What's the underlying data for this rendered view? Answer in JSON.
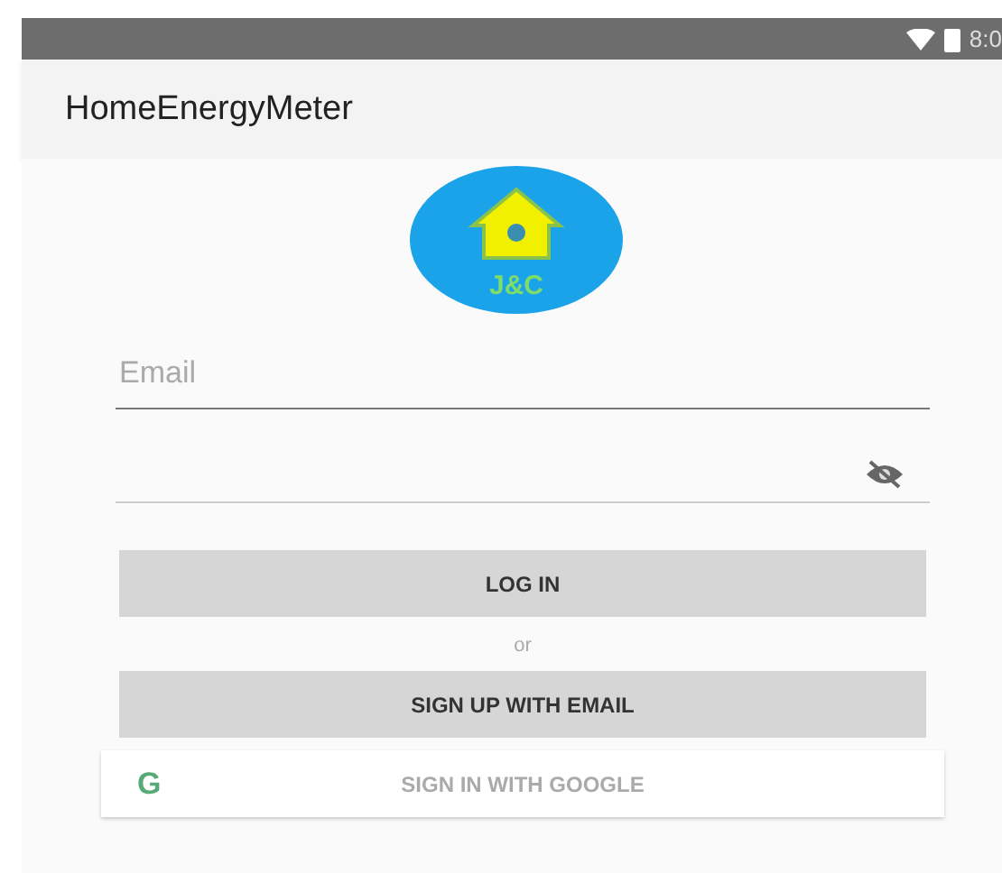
{
  "status_bar": {
    "time": "8:0"
  },
  "app_bar": {
    "title": "HomeEnergyMeter"
  },
  "logo": {
    "text": "J&C"
  },
  "email": {
    "placeholder": "Email"
  },
  "password": {
    "masked": true
  },
  "login_button": "LOG IN",
  "divider_text": "or",
  "signup_button": "SIGN UP WITH EMAIL",
  "google_button": {
    "icon": "G",
    "label": "SIGN IN WITH GOOGLE"
  }
}
